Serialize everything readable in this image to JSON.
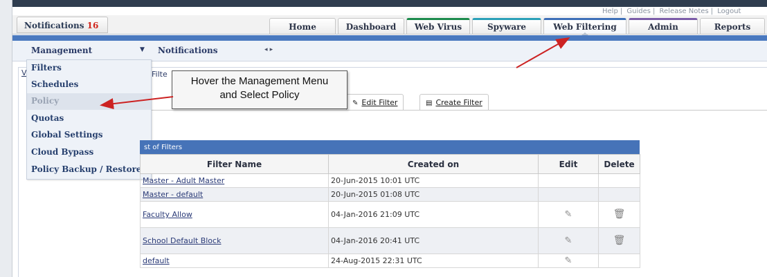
{
  "top_links": [
    "Help",
    "Guides",
    "Release Notes",
    "Logout"
  ],
  "notifications_tab": {
    "label": "Notifications",
    "count": "16"
  },
  "nav_tabs": [
    "Home",
    "Dashboard",
    "Web Virus",
    "Spyware",
    "Web Filtering",
    "Admin",
    "Reports"
  ],
  "subnav": {
    "management": "Management",
    "management_arrow": "▼",
    "notifications": "Notifications",
    "notifications_arrows": "◂ ▸"
  },
  "breadcrumb": {
    "v": "V",
    "filter": "Filte"
  },
  "menu_items": [
    "Filters",
    "Schedules",
    "Policy",
    "Quotas",
    "Global Settings",
    "Cloud Bypass",
    "Policy Backup / Restore"
  ],
  "callout": {
    "line1": "Hover the Management Menu",
    "line2": "and Select Policy"
  },
  "toolbar": {
    "edit_filter": "Edit Filter",
    "create_filter": "Create Filter"
  },
  "table": {
    "caption": "st of Filters",
    "headers": [
      "Filter Name",
      "Created on",
      "Edit",
      "Delete"
    ],
    "rows": [
      {
        "name": "Master - Adult Master",
        "created": "20-Jun-2015 10:01 UTC"
      },
      {
        "name": "Master - default",
        "created": "20-Jun-2015 01:08 UTC"
      },
      {
        "name": "Faculty Allow",
        "created": "04-Jan-2016 21:09 UTC"
      },
      {
        "name": "School Default Block",
        "created": "04-Jan-2016 20:41 UTC"
      },
      {
        "name": "default",
        "created": "24-Aug-2015 22:31 UTC"
      }
    ]
  },
  "colors": {
    "nav_blue": "#4a79bf",
    "table_header": "#4673b8",
    "annotation_arrow": "#cc2222",
    "notification_count": "#d0241b"
  },
  "icons": {
    "edit": "edit-icon",
    "delete": "trash-icon"
  }
}
